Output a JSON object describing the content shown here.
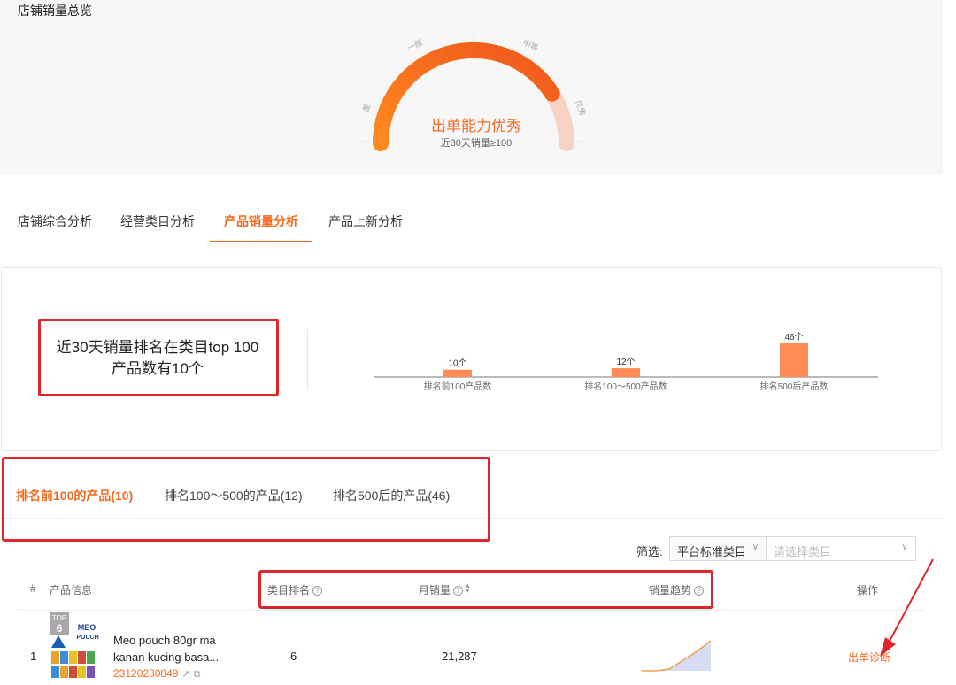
{
  "overview": {
    "title": "店铺销量总览",
    "gauge": {
      "labels": [
        "差",
        "一般",
        "中等",
        "优秀"
      ],
      "level": 0.82,
      "main_text": "出单能力优秀",
      "sub_text": "近30天销量≥100"
    }
  },
  "tabs": [
    {
      "label": "店铺综合分析"
    },
    {
      "label": "经营类目分析"
    },
    {
      "label": "产品销量分析"
    },
    {
      "label": "产品上新分析"
    }
  ],
  "active_tab": 2,
  "stats": {
    "line1": "近30天销量排名在类目top 100",
    "line2": "产品数有10个"
  },
  "chart_data": {
    "type": "bar",
    "categories": [
      "排名前100产品数",
      "排名100～500产品数",
      "排名500后产品数"
    ],
    "values": [
      10,
      12,
      46
    ],
    "data_labels": [
      "10个",
      "12个",
      "46个"
    ],
    "color": "#ff8c55"
  },
  "sub_tabs": [
    {
      "label": "排名前100的产品(10)"
    },
    {
      "label": "排名100～500的产品(12)"
    },
    {
      "label": "排名500后的产品(46)"
    }
  ],
  "filter": {
    "label": "筛选:",
    "select_value": "平台标准类目",
    "placeholder": "请选择类目"
  },
  "table": {
    "headers": {
      "index": "#",
      "product": "产品信息",
      "rank": "类目排名",
      "sales": "月销量",
      "trend": "销量趋势",
      "action": "操作"
    },
    "rows": [
      {
        "index": "1",
        "badge_top": "TOP",
        "badge_num": "6",
        "thumb_brand": "MEO",
        "thumb_sub": "POUCH",
        "name": "Meo pouch 80gr ma kanan kucing basa...",
        "id": "23120280849",
        "rank": "6",
        "sales": "21,287",
        "trend": [
          0,
          0,
          0.05,
          0.3,
          0.55,
          0.85
        ],
        "action": "出单诊断"
      }
    ]
  },
  "colors": {
    "accent": "#f36b21",
    "highlight": "#e0262a"
  }
}
